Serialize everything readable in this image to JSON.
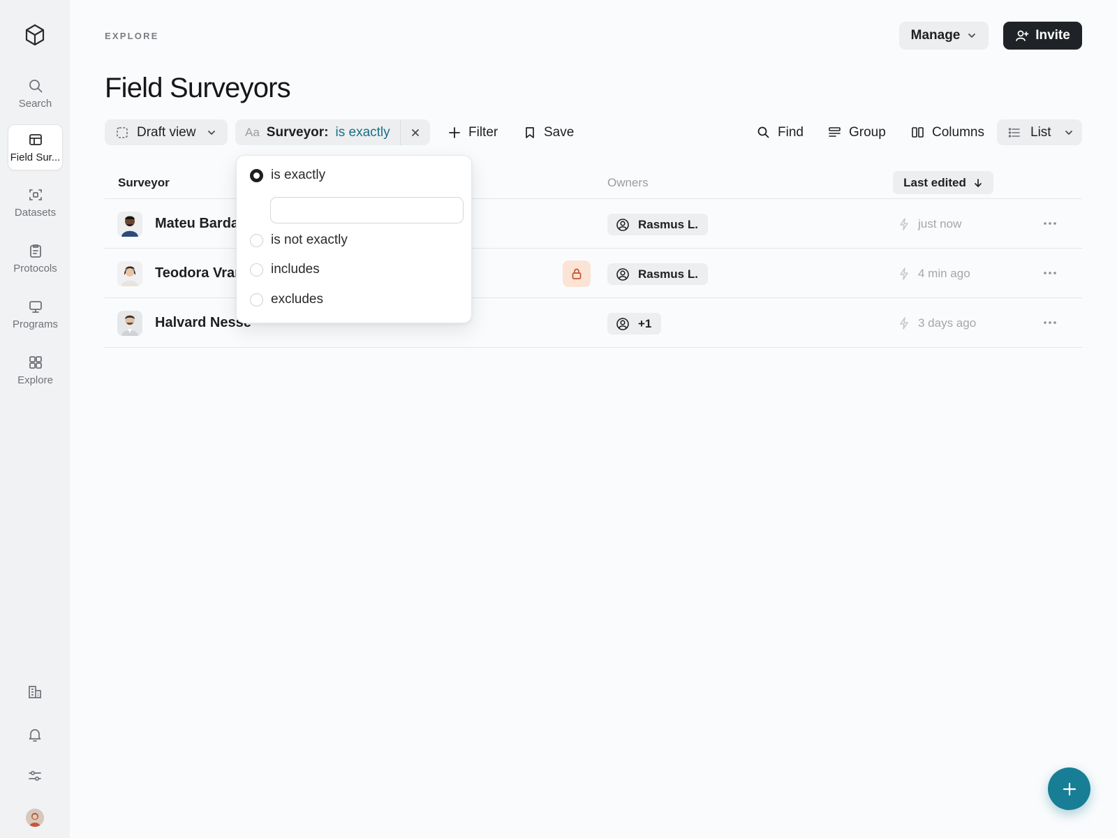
{
  "sidebar": {
    "items": [
      {
        "label": "Search",
        "icon": "search-icon"
      },
      {
        "label": "Field Sur...",
        "icon": "table-icon",
        "active": true
      },
      {
        "label": "Datasets",
        "icon": "scan-icon"
      },
      {
        "label": "Protocols",
        "icon": "clipboard-icon"
      },
      {
        "label": "Programs",
        "icon": "monitor-icon"
      },
      {
        "label": "Explore",
        "icon": "grid-icon"
      }
    ],
    "bottom_icons": [
      "building-icon",
      "bell-icon",
      "sliders-icon",
      "avatar"
    ]
  },
  "header": {
    "eyebrow": "EXPLORE",
    "title": "Field Surveyors",
    "manage_label": "Manage",
    "invite_label": "Invite"
  },
  "toolbar": {
    "view_label": "Draft view",
    "filter_chip": {
      "prefix": "Aa",
      "field": "Surveyor:",
      "operator": "is exactly"
    },
    "filter_label": "Filter",
    "save_label": "Save",
    "find_label": "Find",
    "group_label": "Group",
    "columns_label": "Columns",
    "layout_label": "List"
  },
  "table": {
    "headers": {
      "surveyor": "Surveyor",
      "owners": "Owners",
      "sort": "Last edited"
    },
    "rows": [
      {
        "name": "Mateu Barda",
        "owner": "Rasmus L.",
        "edited": "just now",
        "locked": false
      },
      {
        "name": "Teodora Vrar",
        "owner": "Rasmus L.",
        "edited": "4 min ago",
        "locked": true
      },
      {
        "name": "Halvard Nesse",
        "owner": "+1",
        "edited": "3 days ago",
        "locked": false
      }
    ]
  },
  "filter_dropdown": {
    "options": [
      "is exactly",
      "is not exactly",
      "includes",
      "excludes"
    ],
    "selected": "is exactly",
    "input_value": ""
  },
  "colors": {
    "accent": "#177e95",
    "operator_text": "#1b6f86",
    "lock_badge_bg": "#fbe4d6",
    "lock_icon": "#c2552b"
  }
}
